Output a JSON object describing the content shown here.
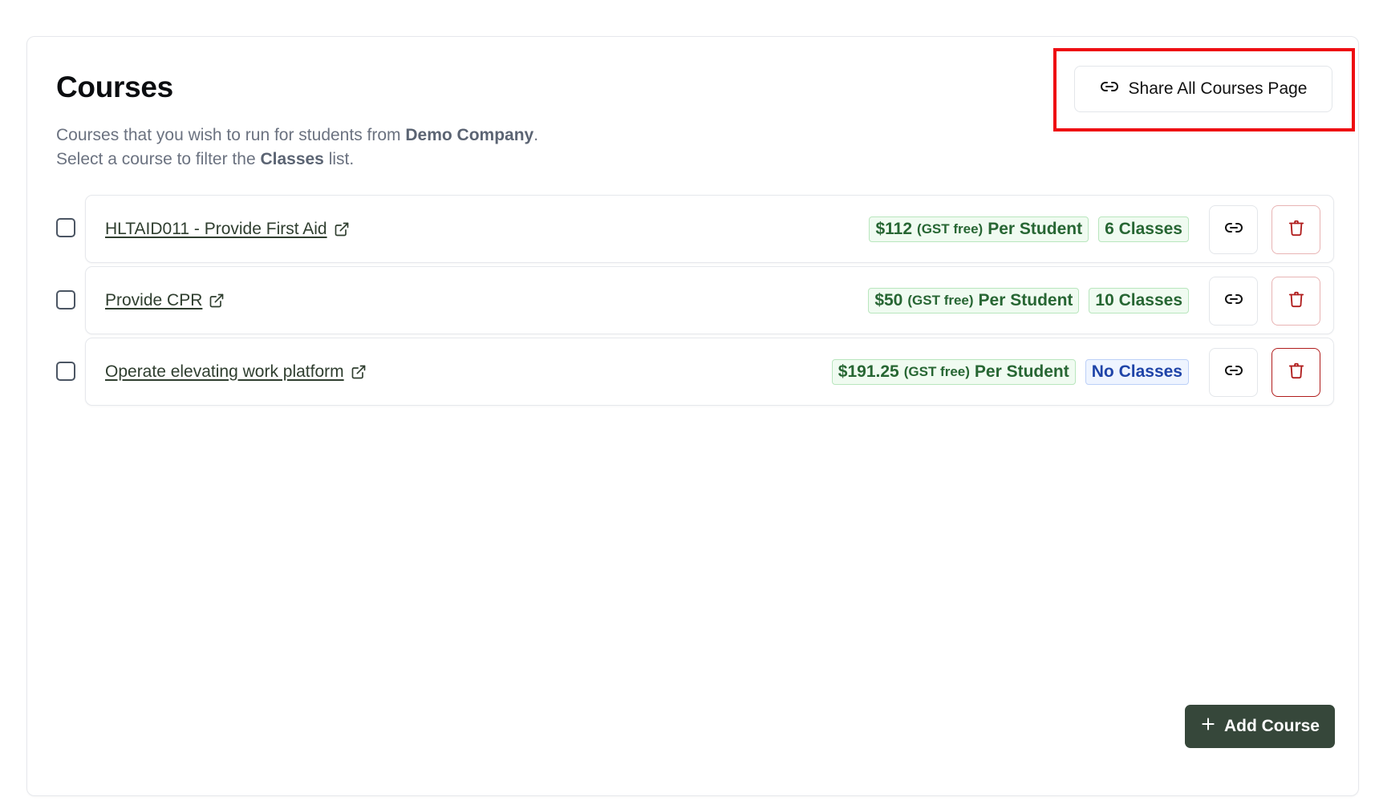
{
  "header": {
    "title": "Courses",
    "desc_prefix": "Courses that you wish to run for students from ",
    "company": "Demo Company",
    "desc_suffix": ".",
    "line2_prefix": "Select a course to filter the ",
    "line2_bold": "Classes",
    "line2_suffix": " list."
  },
  "share_button": {
    "label": "Share All Courses Page",
    "icon": "link-icon"
  },
  "courses": [
    {
      "name": "HLTAID011 - Provide First Aid",
      "price": "$112",
      "gst": "(GST free)",
      "per": "Per Student",
      "classes": "6 Classes",
      "classes_style": "green",
      "checked": false
    },
    {
      "name": "Provide CPR",
      "price": "$50",
      "gst": "(GST free)",
      "per": "Per Student",
      "classes": "10 Classes",
      "classes_style": "green",
      "checked": false
    },
    {
      "name": "Operate elevating work platform",
      "price": "$191.25",
      "gst": "(GST free)",
      "per": "Per Student",
      "classes": "No Classes",
      "classes_style": "blue",
      "checked": false
    }
  ],
  "add_button": {
    "label": "Add Course",
    "icon": "plus-icon"
  },
  "colors": {
    "price_badge": "#276633",
    "no_classes_badge": "#1f44a8",
    "add_button_bg": "#36473a",
    "delete_icon": "#b01c1c",
    "highlight": "#ee0d12"
  }
}
